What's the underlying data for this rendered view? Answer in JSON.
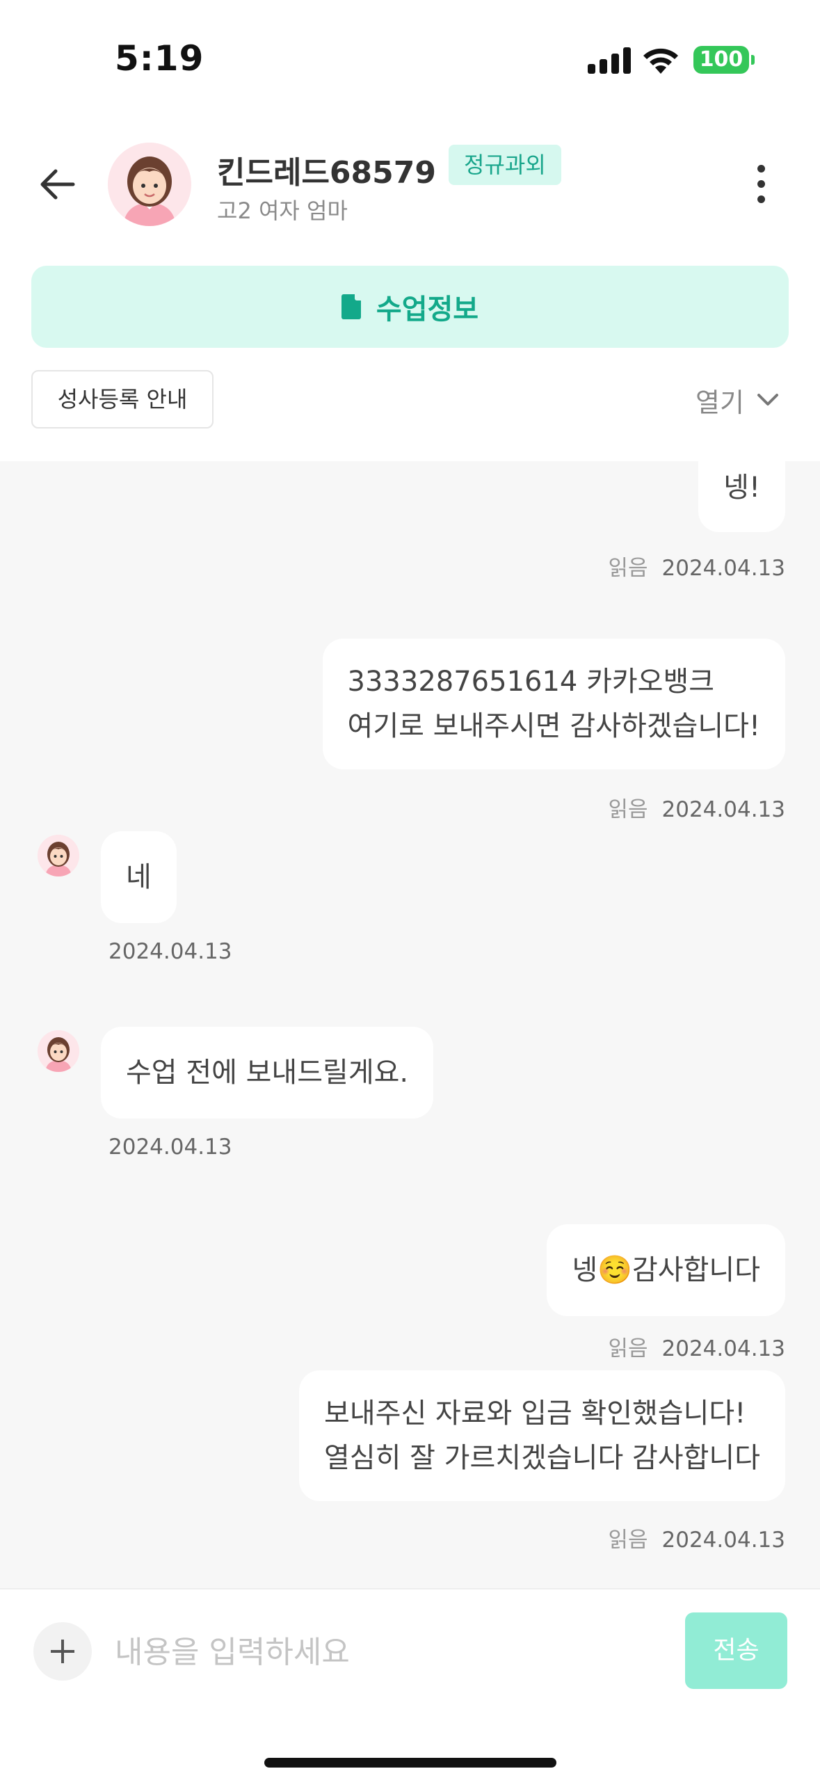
{
  "status_bar": {
    "time": "5:19",
    "battery": "100"
  },
  "header": {
    "name": "킨드레드68579",
    "tag": "정규과외",
    "subtitle": "고2 여자 엄마"
  },
  "class_info_label": "수업정보",
  "guide_label": "성사등록 안내",
  "open_label": "열기",
  "messages": [
    {
      "sender": "me",
      "lines": [
        "넹!"
      ],
      "read": "읽음",
      "date": "2024.04.13"
    },
    {
      "sender": "me",
      "lines": [
        "3333287651614 카카오뱅크",
        "여기로 보내주시면 감사하겠습니다!"
      ],
      "read": "읽음",
      "date": "2024.04.13"
    },
    {
      "sender": "other",
      "lines": [
        "네"
      ],
      "date": "2024.04.13"
    },
    {
      "sender": "other",
      "lines": [
        "수업 전에 보내드릴게요."
      ],
      "date": "2024.04.13"
    },
    {
      "sender": "me",
      "lines": [
        "넹☺️감사합니다"
      ],
      "read": "읽음",
      "date": "2024.04.13"
    },
    {
      "sender": "me",
      "lines": [
        "보내주신 자료와 입금 확인했습니다!",
        "열심히 잘 가르치겠습니다 감사합니다"
      ],
      "read": "읽음",
      "date": "2024.04.13"
    }
  ],
  "input": {
    "placeholder": "내용을 입력하세요",
    "send_label": "전송"
  },
  "colors": {
    "accent": "#13a98a",
    "accent_bg": "#d8f9f0",
    "send_disabled": "#91ecd5",
    "battery": "#34c759"
  }
}
